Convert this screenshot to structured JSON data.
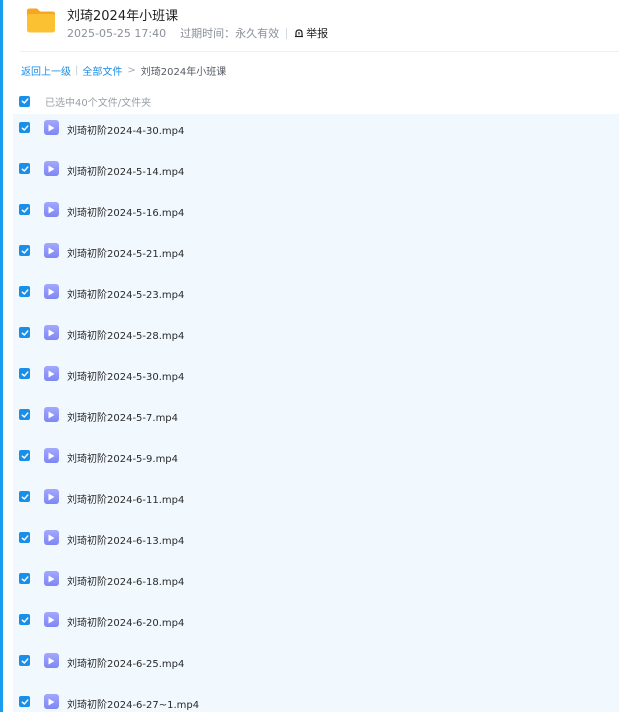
{
  "colors": {
    "accent": "#1a8fe8",
    "list_bg": "#f1f8fe",
    "folder": "#fcc132",
    "video_icon": "#8a90f7"
  },
  "header": {
    "folder_icon": "folder-icon",
    "title": "刘琦2024年小班课",
    "date": "2025-05-25 17:40",
    "expiry_label": "过期时间：",
    "expiry_value": "永久有效",
    "report_icon": "report-icon",
    "report_label": "举报"
  },
  "breadcrumb": {
    "back": "返回上一级",
    "all_files": "全部文件",
    "current": "刘琦2024年小班课"
  },
  "selection": {
    "label": "已选中40个文件/文件夹"
  },
  "files": [
    {
      "name": "刘琦初阶2024-4-30.mp4",
      "icon": "video-file-icon",
      "checked": true
    },
    {
      "name": "刘琦初阶2024-5-14.mp4",
      "icon": "video-file-icon",
      "checked": true
    },
    {
      "name": "刘琦初阶2024-5-16.mp4",
      "icon": "video-file-icon",
      "checked": true
    },
    {
      "name": "刘琦初阶2024-5-21.mp4",
      "icon": "video-file-icon",
      "checked": true
    },
    {
      "name": "刘琦初阶2024-5-23.mp4",
      "icon": "video-file-icon",
      "checked": true
    },
    {
      "name": "刘琦初阶2024-5-28.mp4",
      "icon": "video-file-icon",
      "checked": true
    },
    {
      "name": "刘琦初阶2024-5-30.mp4",
      "icon": "video-file-icon",
      "checked": true
    },
    {
      "name": "刘琦初阶2024-5-7.mp4",
      "icon": "video-file-icon",
      "checked": true
    },
    {
      "name": "刘琦初阶2024-5-9.mp4",
      "icon": "video-file-icon",
      "checked": true
    },
    {
      "name": "刘琦初阶2024-6-11.mp4",
      "icon": "video-file-icon",
      "checked": true
    },
    {
      "name": "刘琦初阶2024-6-13.mp4",
      "icon": "video-file-icon",
      "checked": true
    },
    {
      "name": "刘琦初阶2024-6-18.mp4",
      "icon": "video-file-icon",
      "checked": true
    },
    {
      "name": "刘琦初阶2024-6-20.mp4",
      "icon": "video-file-icon",
      "checked": true
    },
    {
      "name": "刘琦初阶2024-6-25.mp4",
      "icon": "video-file-icon",
      "checked": true
    },
    {
      "name": "刘琦初阶2024-6-27~1.mp4",
      "icon": "video-file-icon",
      "checked": true
    }
  ]
}
